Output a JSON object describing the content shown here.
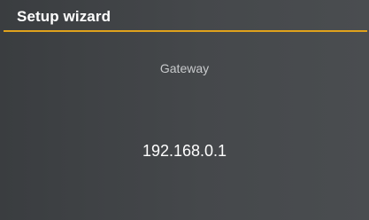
{
  "header": {
    "title": "Setup wizard",
    "accent_color": "#e0a21c"
  },
  "field": {
    "label": "Gateway",
    "value": "192.168.0.1"
  }
}
